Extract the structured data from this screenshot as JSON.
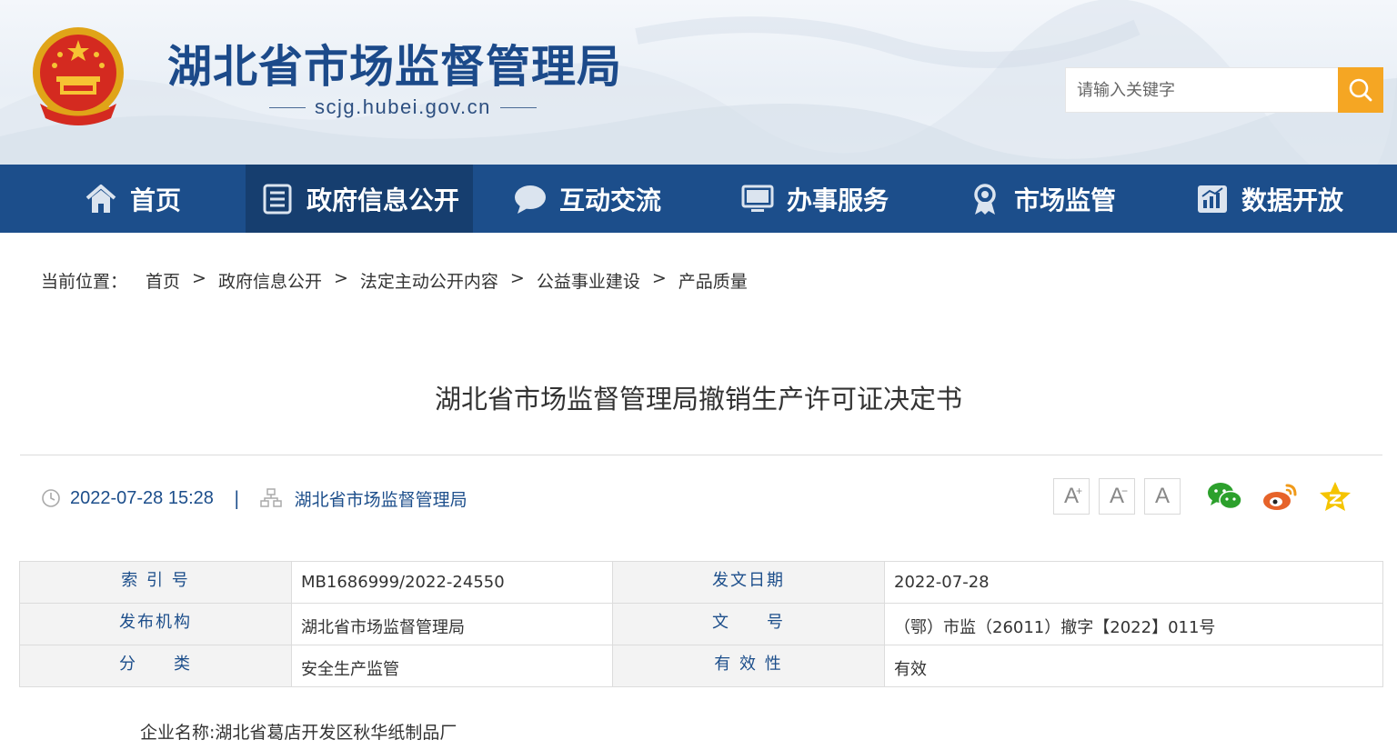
{
  "header": {
    "site_title": "湖北省市场监督管理局",
    "site_url": "scjg.hubei.gov.cn",
    "search_placeholder": "请输入关键字"
  },
  "nav": [
    {
      "label": "首页",
      "icon": "home-icon",
      "active": false
    },
    {
      "label": "政府信息公开",
      "icon": "document-list-icon",
      "active": true
    },
    {
      "label": "互动交流",
      "icon": "chat-bubble-icon",
      "active": false
    },
    {
      "label": "办事服务",
      "icon": "monitor-icon",
      "active": false
    },
    {
      "label": "市场监管",
      "icon": "award-badge-icon",
      "active": false
    },
    {
      "label": "数据开放",
      "icon": "bar-chart-icon",
      "active": false
    }
  ],
  "breadcrumb": {
    "prefix": "当前位置：",
    "items": [
      "首页",
      "政府信息公开",
      "法定主动公开内容",
      "公益事业建设",
      "产品质量"
    ],
    "separator": ">"
  },
  "article": {
    "title": "湖北省市场监督管理局撤销生产许可证决定书",
    "datetime": "2022-07-28 15:28",
    "meta_separator": "|",
    "source": "湖北省市场监督管理局",
    "font_buttons": [
      "A",
      "A",
      "A"
    ],
    "share": [
      "wechat-icon",
      "weibo-icon",
      "qzone-star-icon"
    ],
    "body_first_line": "企业名称:湖北省葛店开发区秋华纸制品厂"
  },
  "info_table": {
    "rows": [
      {
        "label1": "索 引 号",
        "value1": "MB1686999/2022-24550",
        "label2": "发文日期",
        "value2": "2022-07-28"
      },
      {
        "label1": "发布机构",
        "value1": "湖北省市场监督管理局",
        "label2": "文　　号",
        "value2": "（鄂）市监（26011）撤字【2022】011号"
      },
      {
        "label1": "分　　类",
        "value1": "安全生产监管",
        "label2": "有 效 性",
        "value2": "有效"
      }
    ]
  },
  "colors": {
    "brand_blue": "#1c4e8b",
    "nav_active": "#163e6f",
    "search_button": "#f5a623"
  }
}
